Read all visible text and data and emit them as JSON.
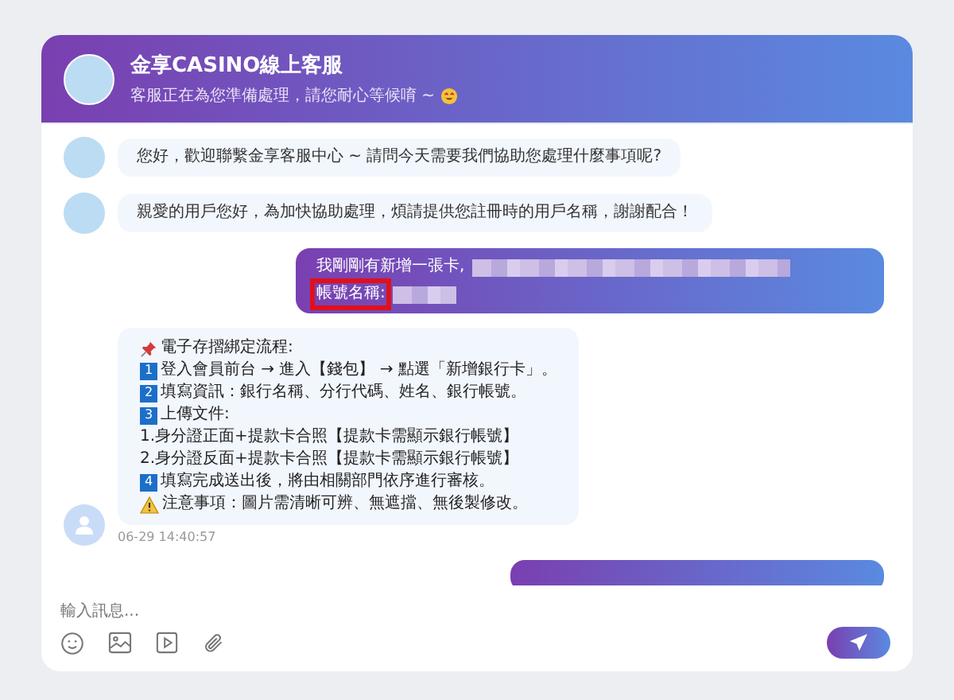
{
  "header": {
    "title": "金享CASINO線上客服",
    "subtitle": "客服正在為您準備處理，請您耐心等候唷 ~"
  },
  "messages": [
    {
      "kind": "agent",
      "text": "您好，歡迎聯繫金享客服中心 ~ 請問今天需要我們協助您處理什麼事項呢?"
    },
    {
      "kind": "agent",
      "text": "親愛的用戶您好，為加快協助處理，煩請提供您註冊時的用戶名稱，謝謝配合！"
    },
    {
      "kind": "user",
      "lines": [
        {
          "text": "我剛剛有新增一張卡,",
          "highlighted": false,
          "redacted": true
        },
        {
          "text": "帳號名稱:",
          "highlighted": true,
          "redacted": true
        }
      ]
    },
    {
      "kind": "steps",
      "time": "06-29 14:40:57",
      "lines": [
        {
          "kind": "pin",
          "text": "電子存摺綁定流程:"
        },
        {
          "kind": "number",
          "number": "1",
          "text": "登入會員前台 → 進入【錢包】 → 點選「新增銀行卡」。"
        },
        {
          "kind": "number",
          "number": "2",
          "text": "填寫資訊：銀行名稱、分行代碼、姓名、銀行帳號。"
        },
        {
          "kind": "number",
          "number": "3",
          "text": "上傳文件:"
        },
        {
          "kind": "plain",
          "text": "1.身分證正面+提款卡合照【提款卡需顯示銀行帳號】"
        },
        {
          "kind": "plain",
          "text": "2.身分證反面+提款卡合照【提款卡需顯示銀行帳號】"
        },
        {
          "kind": "number",
          "number": "4",
          "text": "填寫完成送出後，將由相關部門依序進行審核。"
        },
        {
          "kind": "warning",
          "text": "注意事項：圖片需清晰可辨、無遮擋、無後製修改。"
        }
      ]
    },
    {
      "kind": "user_cut"
    }
  ],
  "composer": {
    "placeholder": "輸入訊息..."
  }
}
